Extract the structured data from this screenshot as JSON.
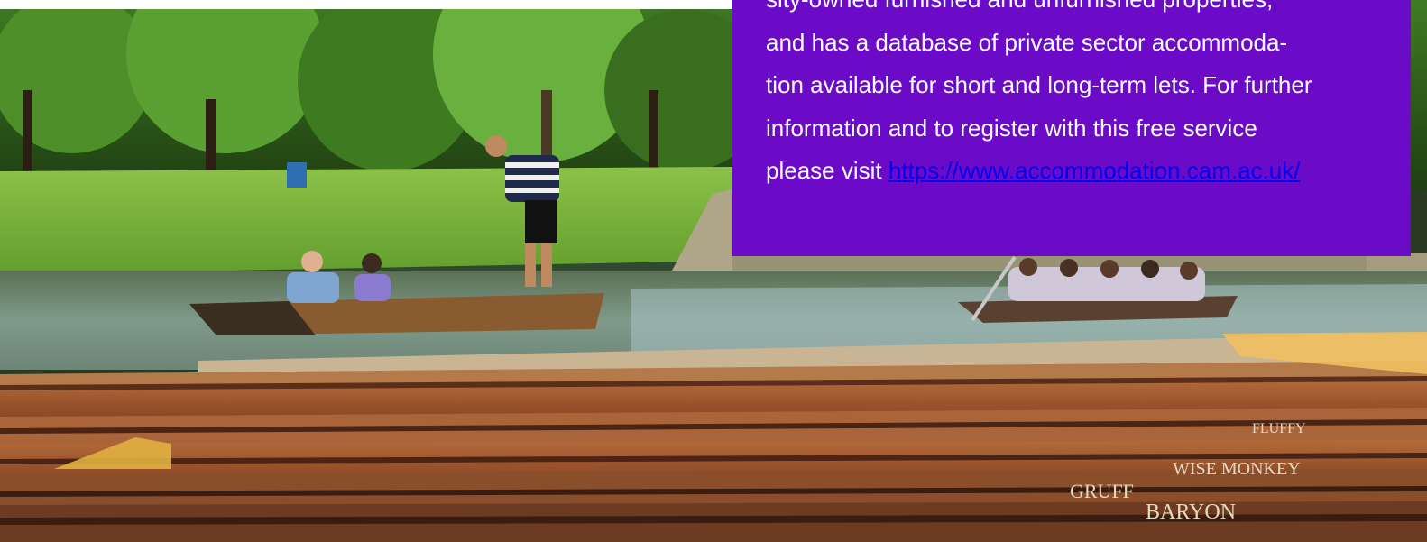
{
  "colors": {
    "panel_bg": "#6b0ac7",
    "panel_text": "#ffffff",
    "link": "#0000ee"
  },
  "info": {
    "lines": [
      "sity-owned furnished and unfurnished properties,",
      "and has a database of private sector accommoda-",
      "tion available for short and long-term lets. For further",
      "information and to register with this free service",
      "please visit "
    ],
    "link_text": "https://www.accommodation.cam.ac.uk/"
  },
  "hero": {
    "punt_names": [
      "GRUFF",
      "BARYON",
      "WISE MONKEY",
      "FLUFFY"
    ]
  }
}
